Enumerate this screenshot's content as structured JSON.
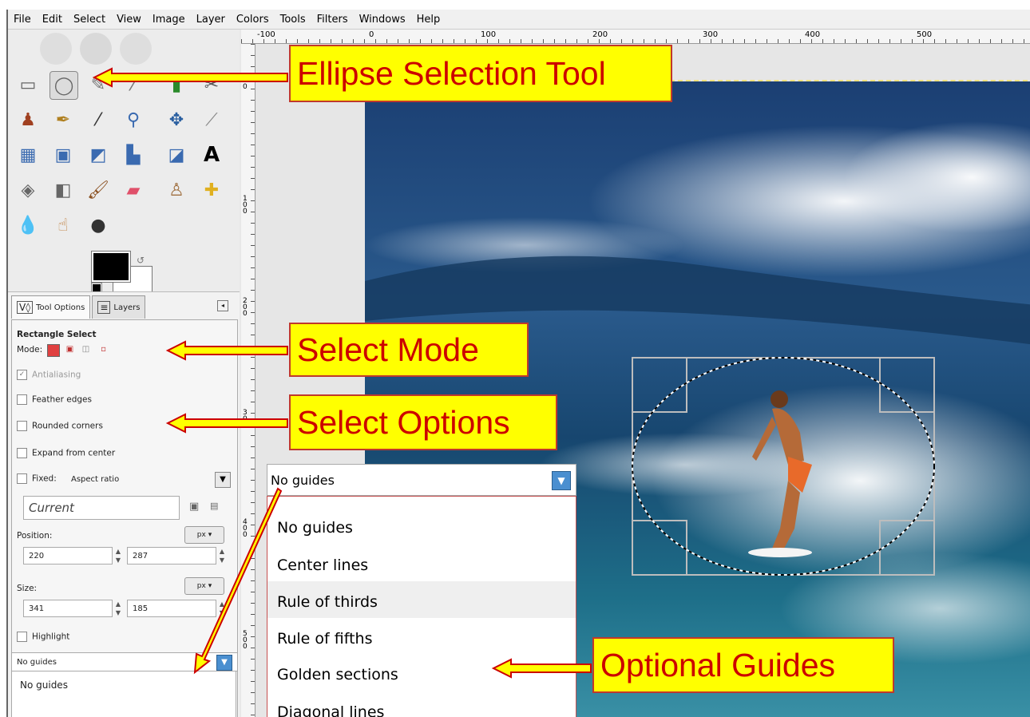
{
  "menubar": {
    "items": [
      "File",
      "Edit",
      "Select",
      "View",
      "Image",
      "Layer",
      "Colors",
      "Tools",
      "Filters",
      "Windows",
      "Help"
    ]
  },
  "ruler": {
    "h_labels": [
      "-100",
      "0",
      "100",
      "200",
      "300",
      "400",
      "500"
    ],
    "v_labels": [
      "0",
      "100",
      "200",
      "300",
      "400",
      "500"
    ]
  },
  "toolbox": {
    "tools": [
      "rect-select-icon",
      "ellipse-select-icon",
      "free-select-icon",
      "fuzzy-select-icon",
      "color-select-icon",
      "scissors-icon",
      "foreground-select-icon",
      "paths-icon",
      "color-picker-icon",
      "zoom-icon",
      "move-icon",
      "measure-icon",
      "align-icon",
      "crop-icon",
      "rotate-icon",
      "scale-icon",
      "perspective-icon",
      "text-icon",
      "bucket-fill-icon",
      "gradient-icon",
      "paintbrush-icon",
      "eraser-icon",
      "clone-icon",
      "heal-icon",
      "blur-icon",
      "smudge-icon",
      "dodge-icon"
    ]
  },
  "tool_options": {
    "tab_options": "Tool Options",
    "tab_layers": "Layers",
    "title": "Rectangle Select",
    "mode_label": "Mode:",
    "antialiasing": "Antialiasing",
    "feather": "Feather edges",
    "rounded": "Rounded corners",
    "expand": "Expand from center",
    "fixed_label": "Fixed:",
    "fixed_value": "Aspect ratio",
    "current": "Current",
    "position_label": "Position:",
    "pos_x": "220",
    "pos_y": "287",
    "pos_unit": "px",
    "size_label": "Size:",
    "size_w": "341",
    "size_h": "185",
    "size_unit": "px",
    "highlight": "Highlight",
    "guides_value": "No guides",
    "guides_first_option": "No guides"
  },
  "guides_dropdown": {
    "value": "No guides",
    "options": [
      "No guides",
      "Center lines",
      "Rule of thirds",
      "Rule of fifths",
      "Golden sections",
      "Diagonal lines"
    ],
    "highlighted_index": 2
  },
  "callouts": {
    "ellipse": "Ellipse Selection Tool",
    "mode": "Select Mode",
    "options": "Select Options",
    "guides": "Optional Guides"
  },
  "colors": {
    "callout_bg": "#ffff00",
    "callout_text": "#cc0000",
    "arrow": "#cc0000"
  }
}
